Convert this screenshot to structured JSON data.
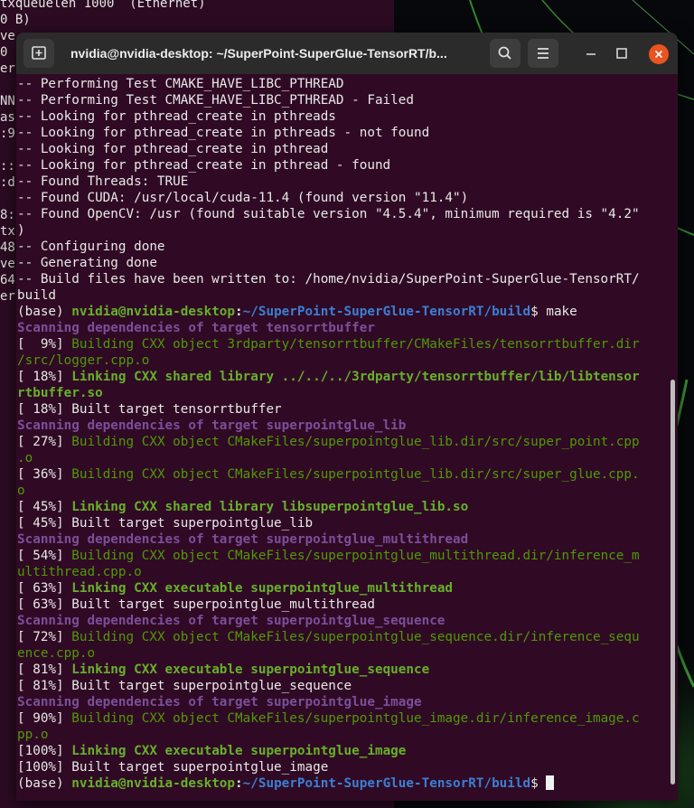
{
  "colors": {
    "terminal_bg": "#300a24",
    "titlebar_bg": "#2b2b2b",
    "close_button": "#e95420",
    "prompt_green": "#66b12a",
    "prompt_blue": "#3b7fd4",
    "scan_purple": "#7a4f9a",
    "build_green": "#4e9a06"
  },
  "background_terminal": {
    "lines": [
      "txqueuelen 1000  (Ethernet)",
      "0 B)",
      "ve",
      "0",
      "er",
      "",
      "NN",
      "as",
      ":9",
      "",
      "::",
      ":d",
      "",
      "8:",
      "tx",
      "48",
      "ve",
      "64",
      "er"
    ]
  },
  "window": {
    "title": "nvidia@nvidia-desktop: ~/SuperPoint-SuperGlue-TensorRT/b...",
    "icons": {
      "new_tab": "new-tab-icon",
      "search": "search-icon",
      "menu": "hamburger-menu-icon",
      "minimize": "minimize-icon",
      "maximize": "maximize-icon",
      "close": "close-icon"
    }
  },
  "terminal": {
    "prompt": {
      "env": "(base) ",
      "user_host": "nvidia@nvidia-desktop",
      "sep": ":",
      "path": "~/SuperPoint-SuperGlue-TensorRT/build",
      "dollar": "$ ",
      "command": "make"
    },
    "lines": [
      [
        {
          "t": "-- Performing Test CMAKE_HAVE_LIBC_PTHREAD",
          "c": "white"
        }
      ],
      [
        {
          "t": "-- Performing Test CMAKE_HAVE_LIBC_PTHREAD - Failed",
          "c": "white"
        }
      ],
      [
        {
          "t": "-- Looking for pthread_create in pthreads",
          "c": "white"
        }
      ],
      [
        {
          "t": "-- Looking for pthread_create in pthreads - not found",
          "c": "white"
        }
      ],
      [
        {
          "t": "-- Looking for pthread_create in pthread",
          "c": "white"
        }
      ],
      [
        {
          "t": "-- Looking for pthread_create in pthread - found",
          "c": "white"
        }
      ],
      [
        {
          "t": "-- Found Threads: TRUE",
          "c": "white"
        }
      ],
      [
        {
          "t": "-- Found CUDA: /usr/local/cuda-11.4 (found version \"11.4\")",
          "c": "white"
        }
      ],
      [
        {
          "t": "-- Found OpenCV: /usr (found suitable version \"4.5.4\", minimum required is \"4.2\"",
          "c": "white"
        }
      ],
      [
        {
          "t": ")",
          "c": "white"
        }
      ],
      [
        {
          "t": "-- Configuring done",
          "c": "white"
        }
      ],
      [
        {
          "t": "-- Generating done",
          "c": "white"
        }
      ],
      [
        {
          "t": "-- Build files have been written to: /home/nvidia/SuperPoint-SuperGlue-TensorRT/",
          "c": "white"
        }
      ],
      [
        {
          "t": "build",
          "c": "white"
        }
      ],
      [
        {
          "t": "(base) ",
          "c": "white"
        },
        {
          "t": "nvidia@nvidia-desktop",
          "c": "bold-green"
        },
        {
          "t": ":",
          "c": "bold-white"
        },
        {
          "t": "~/SuperPoint-SuperGlue-TensorRT/build",
          "c": "bold-blue"
        },
        {
          "t": "$ make",
          "c": "white"
        }
      ],
      [
        {
          "t": "Scanning dependencies of target tensorrtbuffer",
          "c": "scan"
        }
      ],
      [
        {
          "t": "[  9%] ",
          "c": "white"
        },
        {
          "t": "Building CXX object 3rdparty/tensorrtbuffer/CMakeFiles/tensorrtbuffer.dir",
          "c": "green"
        }
      ],
      [
        {
          "t": "/src/logger.cpp.o",
          "c": "green"
        }
      ],
      [
        {
          "t": "[ 18%] ",
          "c": "white"
        },
        {
          "t": "Linking CXX shared library ../../../3rdparty/tensorrtbuffer/lib/libtensor",
          "c": "bold-green"
        }
      ],
      [
        {
          "t": "rtbuffer.so",
          "c": "bold-green"
        }
      ],
      [
        {
          "t": "[ 18%] Built target tensorrtbuffer",
          "c": "white"
        }
      ],
      [
        {
          "t": "Scanning dependencies of target superpointglue_lib",
          "c": "scan"
        }
      ],
      [
        {
          "t": "[ 27%] ",
          "c": "white"
        },
        {
          "t": "Building CXX object CMakeFiles/superpointglue_lib.dir/src/super_point.cpp",
          "c": "green"
        }
      ],
      [
        {
          "t": ".o",
          "c": "green"
        }
      ],
      [
        {
          "t": "[ 36%] ",
          "c": "white"
        },
        {
          "t": "Building CXX object CMakeFiles/superpointglue_lib.dir/src/super_glue.cpp.",
          "c": "green"
        }
      ],
      [
        {
          "t": "o",
          "c": "green"
        }
      ],
      [
        {
          "t": "[ 45%] ",
          "c": "white"
        },
        {
          "t": "Linking CXX shared library libsuperpointglue_lib.so",
          "c": "bold-green"
        }
      ],
      [
        {
          "t": "[ 45%] Built target superpointglue_lib",
          "c": "white"
        }
      ],
      [
        {
          "t": "Scanning dependencies of target superpointglue_multithread",
          "c": "scan"
        }
      ],
      [
        {
          "t": "[ 54%] ",
          "c": "white"
        },
        {
          "t": "Building CXX object CMakeFiles/superpointglue_multithread.dir/inference_m",
          "c": "green"
        }
      ],
      [
        {
          "t": "ultithread.cpp.o",
          "c": "green"
        }
      ],
      [
        {
          "t": "[ 63%] ",
          "c": "white"
        },
        {
          "t": "Linking CXX executable superpointglue_multithread",
          "c": "bold-green"
        }
      ],
      [
        {
          "t": "[ 63%] Built target superpointglue_multithread",
          "c": "white"
        }
      ],
      [
        {
          "t": "Scanning dependencies of target superpointglue_sequence",
          "c": "scan"
        }
      ],
      [
        {
          "t": "[ 72%] ",
          "c": "white"
        },
        {
          "t": "Building CXX object CMakeFiles/superpointglue_sequence.dir/inference_sequ",
          "c": "green"
        }
      ],
      [
        {
          "t": "ence.cpp.o",
          "c": "green"
        }
      ],
      [
        {
          "t": "[ 81%] ",
          "c": "white"
        },
        {
          "t": "Linking CXX executable superpointglue_sequence",
          "c": "bold-green"
        }
      ],
      [
        {
          "t": "[ 81%] Built target superpointglue_sequence",
          "c": "white"
        }
      ],
      [
        {
          "t": "Scanning dependencies of target superpointglue_image",
          "c": "scan"
        }
      ],
      [
        {
          "t": "[ 90%] ",
          "c": "white"
        },
        {
          "t": "Building CXX object CMakeFiles/superpointglue_image.dir/inference_image.c",
          "c": "green"
        }
      ],
      [
        {
          "t": "pp.o",
          "c": "green"
        }
      ],
      [
        {
          "t": "[100%] ",
          "c": "white"
        },
        {
          "t": "Linking CXX executable superpointglue_image",
          "c": "bold-green"
        }
      ],
      [
        {
          "t": "[100%] Built target superpointglue_image",
          "c": "white"
        }
      ],
      [
        {
          "t": "(base) ",
          "c": "white"
        },
        {
          "t": "nvidia@nvidia-desktop",
          "c": "bold-green"
        },
        {
          "t": ":",
          "c": "bold-white"
        },
        {
          "t": "~/SuperPoint-SuperGlue-TensorRT/build",
          "c": "bold-blue"
        },
        {
          "t": "$ ",
          "c": "white"
        },
        {
          "t": "",
          "c": "cursor"
        }
      ]
    ]
  }
}
